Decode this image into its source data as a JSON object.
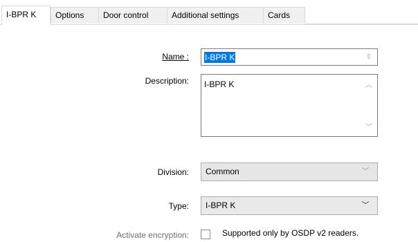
{
  "tabs": [
    {
      "label": "I-BPR K",
      "active": true
    },
    {
      "label": "Options"
    },
    {
      "label": "Door control"
    },
    {
      "label": "Additional settings"
    },
    {
      "label": "Cards"
    }
  ],
  "form": {
    "name_label": "Name :",
    "name_value": "I-BPR K",
    "description_label": "Description:",
    "description_value": "I-BPR K",
    "division_label": "Division:",
    "division_value": "Common",
    "type_label": "Type:",
    "type_value": "I-BPR K",
    "encryption_label": "Activate encryption:",
    "encryption_checked": false,
    "encryption_note": "Supported only by OSDP v2 readers."
  },
  "icons": {
    "spin": "spin-arrows-icon",
    "scroll_up": "scroll-up-icon",
    "scroll_down": "scroll-down-icon",
    "dropdown": "chevron-down-icon"
  },
  "colors": {
    "selection": "#0078d7",
    "disabled_text": "#6d6d6d",
    "field_border": "#7a7a7a"
  }
}
